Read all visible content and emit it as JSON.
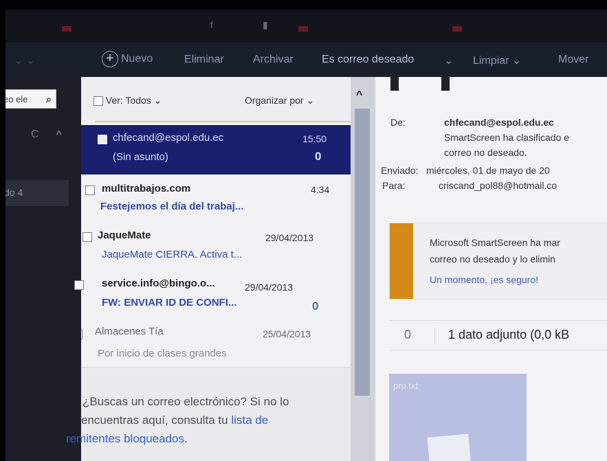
{
  "toolbar": {
    "new_label": "Nuevo",
    "delete_label": "Eliminar",
    "archive_label": "Archivar",
    "junk_label": "Es correo deseado",
    "clean_label": "Limpiar",
    "move_label": "Mover"
  },
  "left": {
    "search_placeholder": "eo ele",
    "folder_partial": "do 4"
  },
  "list": {
    "view_label": "Ver: Todos",
    "sort_label": "Organizar por",
    "messages": [
      {
        "sender": "chfecand@espol.edu.ec",
        "subject": "(Sin asunto)",
        "time": "15:50",
        "attachment": true,
        "selected": true
      },
      {
        "sender": "multitrabajos.com",
        "subject": "Festejemos el día del trabaj...",
        "time": "4:34",
        "attachment": false,
        "selected": false
      },
      {
        "sender": "JaqueMate",
        "subject": "JaqueMate CIERRA. Activa t...",
        "time": "29/04/2013",
        "attachment": false,
        "selected": false
      },
      {
        "sender": "service.info@bingo.o...",
        "subject": "FW: ENVIAR ID DE CONFI...",
        "time": "29/04/2013",
        "attachment": true,
        "selected": false
      },
      {
        "sender": "Almacenes Tía",
        "subject": "Por inicio de clases grandes",
        "time": "25/04/2013",
        "attachment": false,
        "selected": false
      }
    ],
    "footer_text_1": "¿Buscas un correo electrónico? Si no lo",
    "footer_text_2": "encuentras aquí, consulta tu",
    "footer_link_1": "lista de",
    "footer_link_2": "remitentes bloqueados",
    "footer_end": "."
  },
  "reading": {
    "from_label": "De:",
    "from_value": "chfecand@espol.edu.ec",
    "from_note_1": "SmartScreen ha clasificado e",
    "from_note_2": "correo no deseado.",
    "sent_label": "Enviado:",
    "sent_value": "miércoles, 01 de mayo de 20",
    "to_label": "Para:",
    "to_value": "criscand_pol88@hotmail.co",
    "warning_line_1": "Microsoft SmartScreen ha mar",
    "warning_line_2": "correo no deseado y lo elimin",
    "warning_link": "Un momento, ¡es seguro!",
    "attachment_text": "1 dato adjunto (0,0 kB",
    "attachment_name": "pro.txt"
  },
  "colors": {
    "selected_row": "#1b1f70",
    "link": "#3a5cc8",
    "warning_bar": "#d58a17",
    "toolbar_bg": "#1a1f2c"
  }
}
